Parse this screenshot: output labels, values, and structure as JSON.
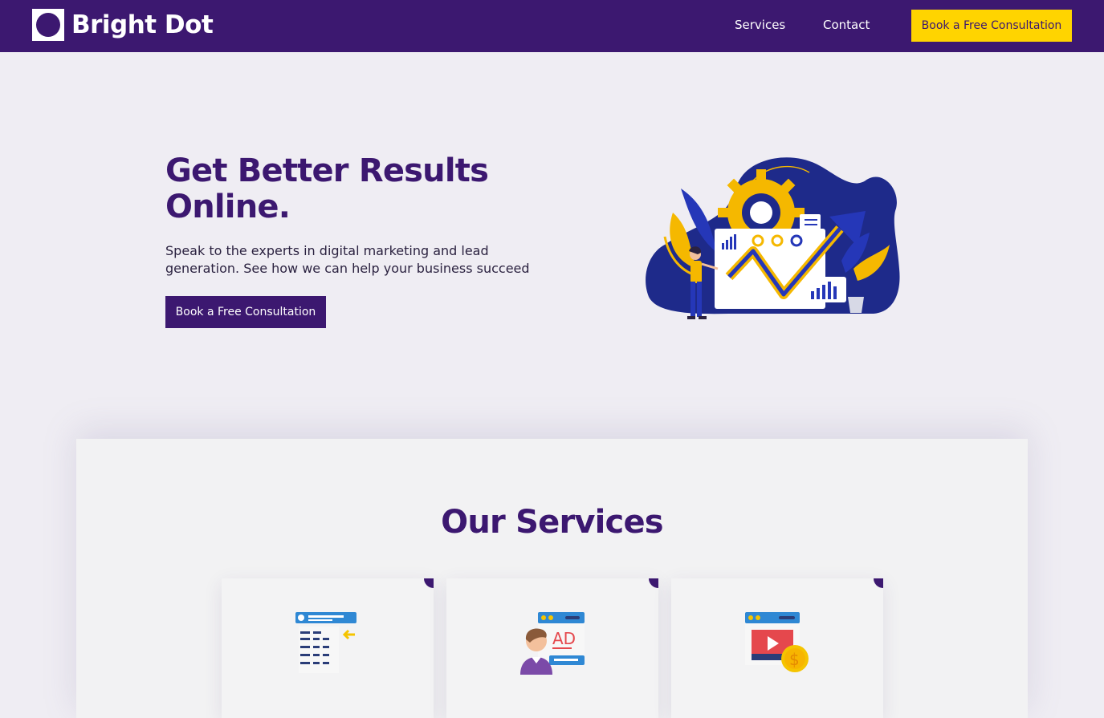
{
  "brand": {
    "name": "Bright Dot"
  },
  "nav": {
    "items": [
      {
        "label": "Services"
      },
      {
        "label": "Contact"
      }
    ],
    "cta_label": "Book a Free Consultation"
  },
  "hero": {
    "title": "Get Better Results Online.",
    "subtitle": "Speak to the experts in digital marketing and lead generation. See how we can help your business succeed",
    "cta_label": "Book a Free Consultation",
    "illustration": "marketing-growth-illustration"
  },
  "services": {
    "title": "Our Services",
    "cards": [
      {
        "icon": "seo-search-results-icon"
      },
      {
        "icon": "advertising-icon"
      },
      {
        "icon": "video-monetization-icon"
      }
    ]
  },
  "colors": {
    "brand_purple": "#3c1870",
    "accent_yellow": "#ffd400",
    "page_bg": "#efedf3",
    "illustration_navy": "#1e2a8a"
  }
}
